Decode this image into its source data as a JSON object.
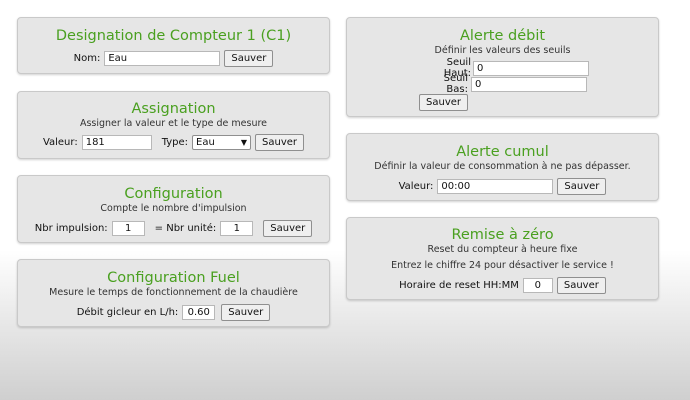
{
  "designation": {
    "title": "Designation de Compteur 1 (C1)",
    "nom_label": "Nom:",
    "nom_value": "Eau",
    "save": "Sauver"
  },
  "assignation": {
    "title": "Assignation",
    "subtitle": "Assigner la valeur et le type de mesure",
    "valeur_label": "Valeur:",
    "valeur_value": "181",
    "type_label": "Type:",
    "type_value": "Eau",
    "save": "Sauver"
  },
  "configuration": {
    "title": "Configuration",
    "subtitle": "Compte le nombre d'impulsion",
    "impulsion_label": "Nbr impulsion:",
    "impulsion_value": "1",
    "unite_label": "= Nbr unité:",
    "unite_value": "1",
    "save": "Sauver"
  },
  "fuel": {
    "title": "Configuration Fuel",
    "subtitle": "Mesure le temps de fonctionnement de la chaudière",
    "debit_label": "Débit gicleur en L/h:",
    "debit_value": "0.60",
    "save": "Sauver"
  },
  "alerte_debit": {
    "title": "Alerte débit",
    "subtitle": "Définir les valeurs des seuils",
    "haut_label": "Seuil Haut:",
    "haut_value": "0",
    "bas_label": "Seuil Bas:",
    "bas_value": "0",
    "save": "Sauver"
  },
  "alerte_cumul": {
    "title": "Alerte cumul",
    "subtitle": "Définir la valeur de consommation à ne pas dépasser.",
    "valeur_label": "Valeur:",
    "valeur_value": "00:00",
    "save": "Sauver"
  },
  "remise": {
    "title": "Remise à zéro",
    "subtitle": "Reset du compteur à heure fixe",
    "note": "Entrez le chiffre 24 pour désactiver le service !",
    "horaire_label": "Horaire de reset HH:MM",
    "horaire_value": "0",
    "save": "Sauver"
  },
  "colors": {
    "title": "#4aa020",
    "panel": "#e6e6e6"
  }
}
